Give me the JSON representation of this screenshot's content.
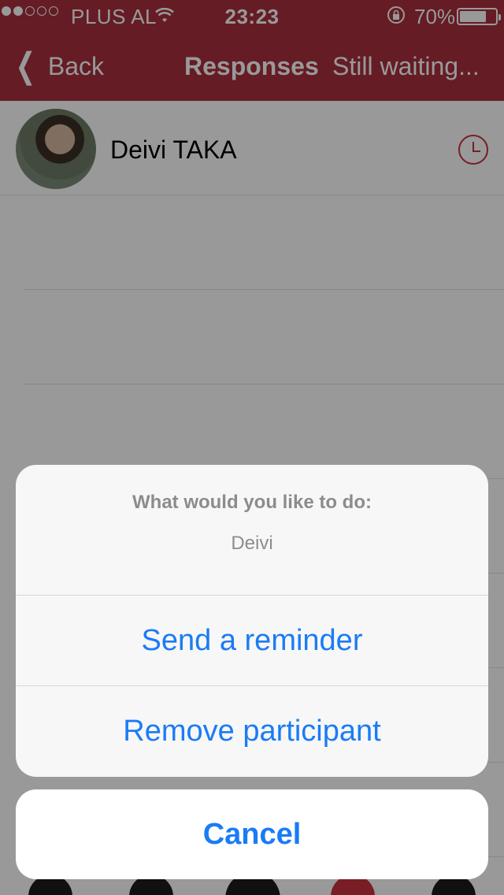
{
  "status_bar": {
    "carrier": "PLUS AL",
    "time": "23:23",
    "battery": "70%"
  },
  "nav": {
    "back_label": "Back",
    "title": "Responses",
    "subtitle": "Still waiting..."
  },
  "list": {
    "items": [
      {
        "name": "Deivi TAKA"
      }
    ]
  },
  "action_sheet": {
    "title": "What would you like to do:",
    "message": "Deivi",
    "actions": [
      {
        "label": "Send a reminder"
      },
      {
        "label": "Remove participant"
      }
    ],
    "cancel_label": "Cancel"
  },
  "colors": {
    "nav_bar": "#a8303c",
    "action_blue": "#1a7cf5",
    "clock_red": "#c8323c"
  }
}
